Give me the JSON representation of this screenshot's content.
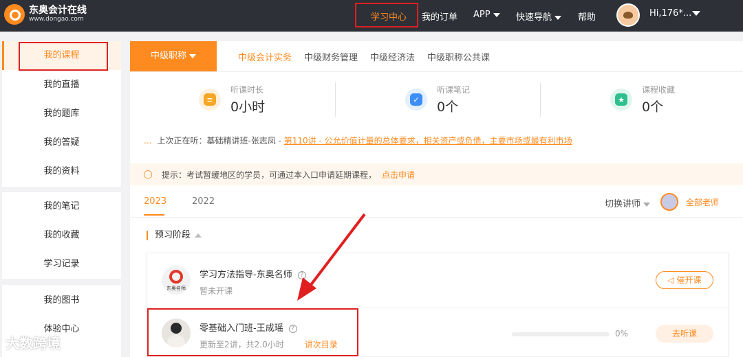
{
  "brand": {
    "name": "东奥会计在线",
    "url": "www.dongao.com"
  },
  "nav": {
    "items": [
      "学习中心",
      "我的订单",
      "APP",
      "快速导航",
      "帮助"
    ],
    "user": "Hi,176*..."
  },
  "sidebar": {
    "group1": [
      "我的课程",
      "我的直播",
      "我的题库",
      "我的答疑",
      "我的资料"
    ],
    "group2": [
      "我的笔记",
      "我的收藏",
      "学习记录"
    ],
    "group3": [
      "我的图书",
      "体验中心"
    ]
  },
  "category": {
    "label": "中级职称",
    "tabs": [
      "中级会计实务",
      "中级财务管理",
      "中级经济法",
      "中级职称公共课"
    ]
  },
  "stats": [
    {
      "label": "听课时长",
      "value": "0小时",
      "icon": "clock-icon",
      "color": "#f5a623"
    },
    {
      "label": "听课笔记",
      "value": "0个",
      "icon": "note-icon",
      "color": "#3a8ef6"
    },
    {
      "label": "课程收藏",
      "value": "0个",
      "icon": "star-icon",
      "color": "#2fbf8f"
    }
  ],
  "last_watch": {
    "dots": "...",
    "prefix": "上次正在听：基础精讲班-张志凤 -",
    "link": "第110讲 - 公允价值计量的总体要求，相关资产或负债，主要市场或最有利市场"
  },
  "notice": {
    "text": "提示：考试暂缓地区的学员，可通过本入口申请延期课程，",
    "link": "点击申请"
  },
  "years": [
    "2023",
    "2022"
  ],
  "teacher_switch": {
    "label": "切换讲师",
    "all": "全部老师"
  },
  "stage": {
    "title": "预习阶段"
  },
  "courses": [
    {
      "title": "学习方法指导-东奥名师",
      "sub": "暂未开课",
      "logo_text": "东奥名师",
      "button": "催开课"
    },
    {
      "title": "零基础入门班-王成瑶",
      "sub": "更新至2讲，共2.0小时",
      "sub_link": "讲次目录",
      "progress": 0,
      "progress_text": "0%",
      "button": "去听课"
    }
  ],
  "watermark": "大数跨境",
  "colors": {
    "accent": "#ff8a1f",
    "highlight": "#e02020",
    "header": "#2e3037"
  }
}
